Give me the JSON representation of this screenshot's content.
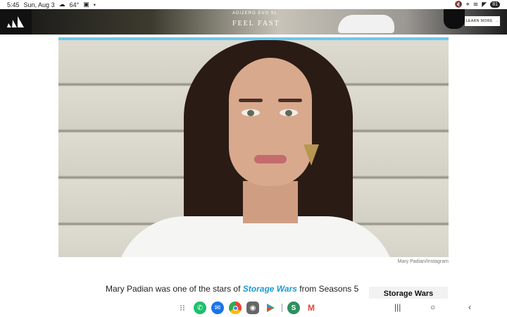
{
  "status_bar": {
    "time": "5:45",
    "date": "Sun, Aug 3",
    "temperature": "64°",
    "battery": "81"
  },
  "ad": {
    "brand_icon": "adidas-logo",
    "subtitle": "ADIZERO EVO SL",
    "headline": "FEEL FAST",
    "cta": "LEARN MORE"
  },
  "article": {
    "photo_alt_icon": "portrait-photo",
    "photo_credit": "Mary Padian/Instagram",
    "body_start": "Mary Padian was one of the stars of ",
    "body_link": "Storage Wars",
    "body_end": " from Seasons 5",
    "sidebar_title": "Storage Wars"
  },
  "colors": {
    "accent": "#6cc7ef",
    "link": "#1a9bd6"
  },
  "navbar": {
    "apps": [
      "apps-grid-icon",
      "phone-icon",
      "messages-icon",
      "chrome-icon",
      "camera-icon",
      "play-store-icon",
      "s-app-icon",
      "gmail-icon"
    ],
    "system": [
      "recents-icon",
      "home-icon",
      "back-icon"
    ]
  }
}
